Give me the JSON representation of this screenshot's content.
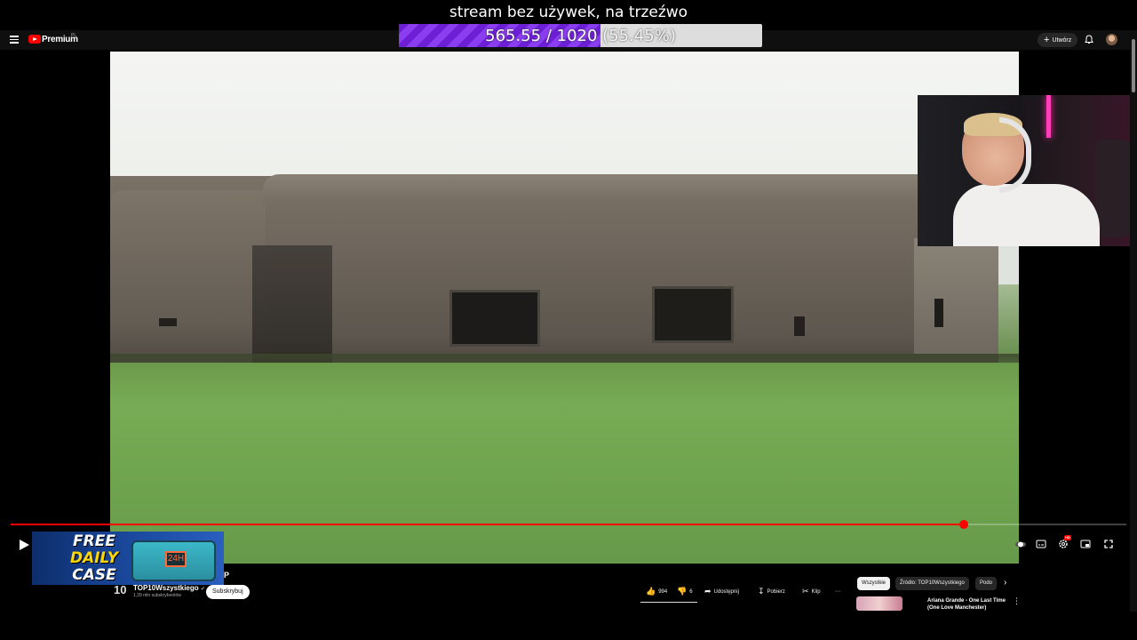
{
  "overlay": {
    "title": "stream bez używek, na trzeźwo",
    "progress_text": "565.55 / 1020",
    "progress_percent_text": "(55.45%)",
    "progress_fraction": 0.5545,
    "fill_color": "#7b2fe6"
  },
  "topbar": {
    "brand": "Premium",
    "region": "PL",
    "create_label": "Utwórz",
    "icons": [
      "menu-icon",
      "youtube-logo-icon",
      "plus-icon",
      "bell-icon",
      "avatar"
    ]
  },
  "player": {
    "progress_fraction": 0.854,
    "accent_color": "#ff0000",
    "hd_badge": "HD"
  },
  "promo": {
    "line1": "FREE",
    "line2": "DAILY",
    "line3": "CASE",
    "badge": "24H"
  },
  "video_info": {
    "title_fragment": "P",
    "channel_logo": "10",
    "channel_name": "TOP10Wszystkiego",
    "channel_subs": "1,39 mln subskrybentów",
    "subscribe_label": "Subskrybuj",
    "likes": "994",
    "dislikes": "6",
    "share_label": "Udostępnij",
    "download_label": "Pobierz",
    "clip_label": "Klip",
    "more_label": "⋯"
  },
  "recommendations": {
    "chips": [
      "Wszystkie",
      "Źródło: TOP10Wszystkiego",
      "Podo"
    ],
    "first_title": "Ariana Grande - One Last Time (One Love Manchester)"
  }
}
